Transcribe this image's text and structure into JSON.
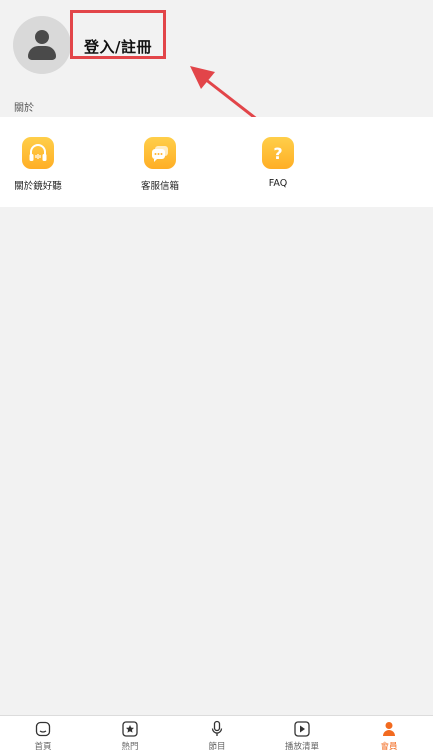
{
  "profile": {
    "login_label": "登入/註冊"
  },
  "about": {
    "section_title": "關於",
    "items": [
      {
        "label": "關於鏡好聽",
        "icon": "headphones-icon"
      },
      {
        "label": "客服信箱",
        "icon": "chat-icon"
      },
      {
        "label": "FAQ",
        "icon": "question-icon"
      }
    ]
  },
  "bottom_nav": {
    "items": [
      {
        "label": "首頁",
        "icon": "home-icon"
      },
      {
        "label": "熱門",
        "icon": "star-icon"
      },
      {
        "label": "節目",
        "icon": "microphone-icon"
      },
      {
        "label": "播放清單",
        "icon": "play-icon"
      },
      {
        "label": "會員",
        "icon": "user-icon",
        "active": true
      }
    ]
  },
  "colors": {
    "accent": "#f26a1f",
    "annotation": "#e24549",
    "icon_bg": "#ffbf38"
  }
}
